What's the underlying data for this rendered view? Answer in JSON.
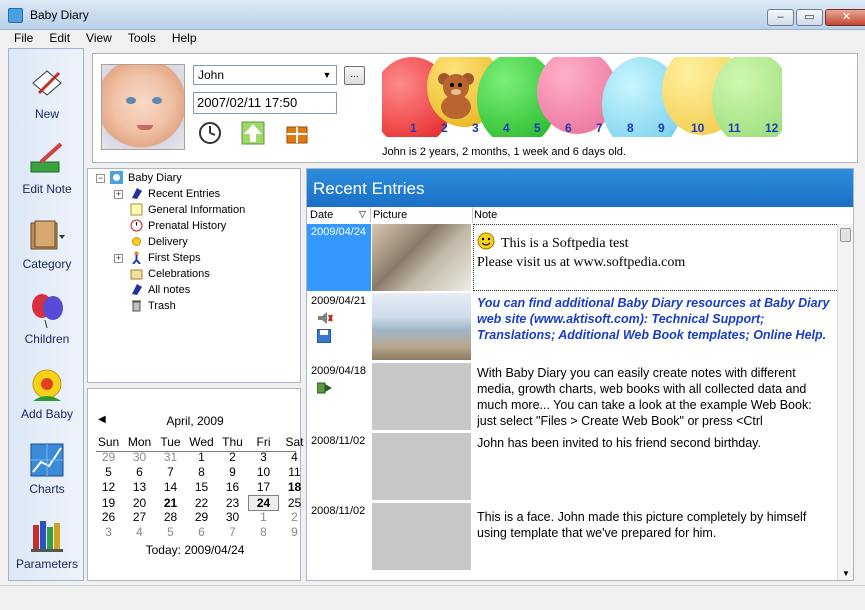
{
  "window": {
    "title": "Baby Diary"
  },
  "menu": [
    "File",
    "Edit",
    "View",
    "Tools",
    "Help"
  ],
  "sidebar": [
    {
      "label": "New",
      "icon": "new-note-icon"
    },
    {
      "label": "Edit Note",
      "icon": "edit-note-icon"
    },
    {
      "label": "Category",
      "icon": "category-icon"
    },
    {
      "label": "Children",
      "icon": "children-icon"
    },
    {
      "label": "Add Baby",
      "icon": "add-baby-icon"
    },
    {
      "label": "Charts",
      "icon": "charts-icon"
    },
    {
      "label": "Parameters",
      "icon": "parameters-icon"
    }
  ],
  "profile": {
    "child_name": "John",
    "browse_label": "...",
    "datetime": "2007/02/11 17:50",
    "months": [
      "1",
      "2",
      "3",
      "4",
      "5",
      "6",
      "7",
      "8",
      "9",
      "10",
      "11",
      "12"
    ],
    "age_text": "John is 2 years, 2 months, 1 week and 6 days old."
  },
  "tree": {
    "root": "Baby Diary",
    "items": [
      "Recent Entries",
      "General Information",
      "Prenatal History",
      "Delivery",
      "First Steps",
      "Celebrations",
      "All notes",
      "Trash"
    ]
  },
  "calendar": {
    "month": "April, 2009",
    "weekdays": [
      "Sun",
      "Mon",
      "Tue",
      "Wed",
      "Thu",
      "Fri",
      "Sat"
    ],
    "weeks": [
      [
        "29",
        "30",
        "31",
        "1",
        "2",
        "3",
        "4"
      ],
      [
        "5",
        "6",
        "7",
        "8",
        "9",
        "10",
        "11"
      ],
      [
        "12",
        "13",
        "14",
        "15",
        "16",
        "17",
        "18"
      ],
      [
        "19",
        "20",
        "21",
        "22",
        "23",
        "24",
        "25"
      ],
      [
        "26",
        "27",
        "28",
        "29",
        "30",
        "1",
        "2"
      ],
      [
        "3",
        "4",
        "5",
        "6",
        "7",
        "8",
        "9"
      ]
    ],
    "today_label": "Today: 2009/04/24"
  },
  "entries": {
    "header": "Recent Entries",
    "columns": {
      "date": "Date",
      "picture": "Picture",
      "note": "Note"
    },
    "rows": [
      {
        "date": "2009/04/24",
        "note_line1": "This is a Softpedia test",
        "note_line2": "Please visit us at www.softpedia.com"
      },
      {
        "date": "2009/04/21",
        "note": "You can find additional Baby Diary resources at Baby Diary web site (www.aktisoft.com): Technical Support; Translations; Additional Web Book templates; Online Help."
      },
      {
        "date": "2009/04/18",
        "note": "With Baby Diary you can easily create notes with different media, growth charts, web books with all collected data and much more... You can take a look at the example Web Book: just select \"Files > Create Web Book\" or press <Ctrl"
      },
      {
        "date": "2008/11/02",
        "note": "John has been invited to his friend second birthday."
      },
      {
        "date": "2008/11/02",
        "note": "This is a face. John made this picture completely by himself using template that we've prepared for him."
      }
    ]
  },
  "colors": {
    "accent": "#1a6fc6",
    "selected_row": "#3399ff",
    "link_note": "#1a3cc8"
  }
}
